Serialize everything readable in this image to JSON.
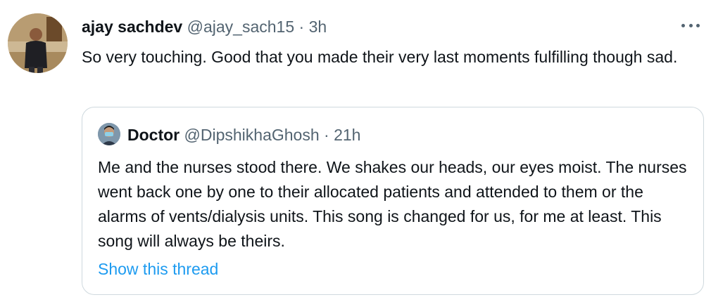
{
  "tweet": {
    "author_name": "ajay sachdev",
    "author_handle": "@ajay_sach15",
    "separator": "·",
    "time": "3h",
    "text": "So very touching. Good that you made their very last moments fulfilling though sad.",
    "more_icon": "more-horizontal-icon"
  },
  "quote": {
    "author_name": "Doctor",
    "author_handle": "@DipshikhaGhosh",
    "separator": "·",
    "time": "21h",
    "text": "Me and the nurses stood there. We shakes our heads, our eyes moist. The nurses went back one by one to their allocated patients and attended to them or the alarms of vents/dialysis units. This song is changed for us, for me at least. This song will always be theirs.",
    "show_thread_label": "Show this thread"
  },
  "colors": {
    "text_primary": "#0f1419",
    "text_secondary": "#536471",
    "link": "#1d9bf0",
    "border": "#cfd9de"
  }
}
